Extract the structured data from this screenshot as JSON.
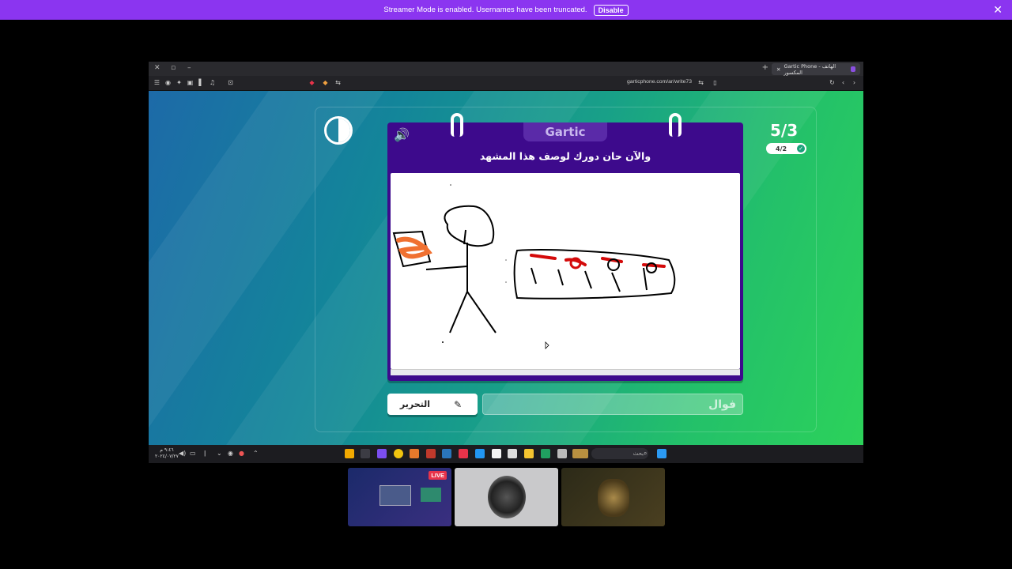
{
  "banner": {
    "message": "Streamer Mode is enabled. Usernames have been truncated.",
    "disable_label": "Disable"
  },
  "browser": {
    "tab_title": "Gartic Phone - الهاتف المكسور",
    "url": "garticphone.com/ar/write73"
  },
  "game": {
    "logo": "Gartic",
    "prompt": "والآن حان دورك لوصف هذا المشهد",
    "round": "5/3",
    "done_count": "4/2",
    "edit_label": "التحرير",
    "answer_value": "",
    "answer_placeholder": "فوال"
  },
  "taskbar": {
    "clock": "٩:٤٦ م",
    "date": "٢٠٢٤/٠٧/٢٧",
    "search_placeholder": "بحث"
  },
  "thumbnails": {
    "live_label": "LIVE"
  },
  "colors": {
    "banner": "#8b35f0",
    "card": "#3d0a8c",
    "prompt_text": "#ffffff"
  }
}
